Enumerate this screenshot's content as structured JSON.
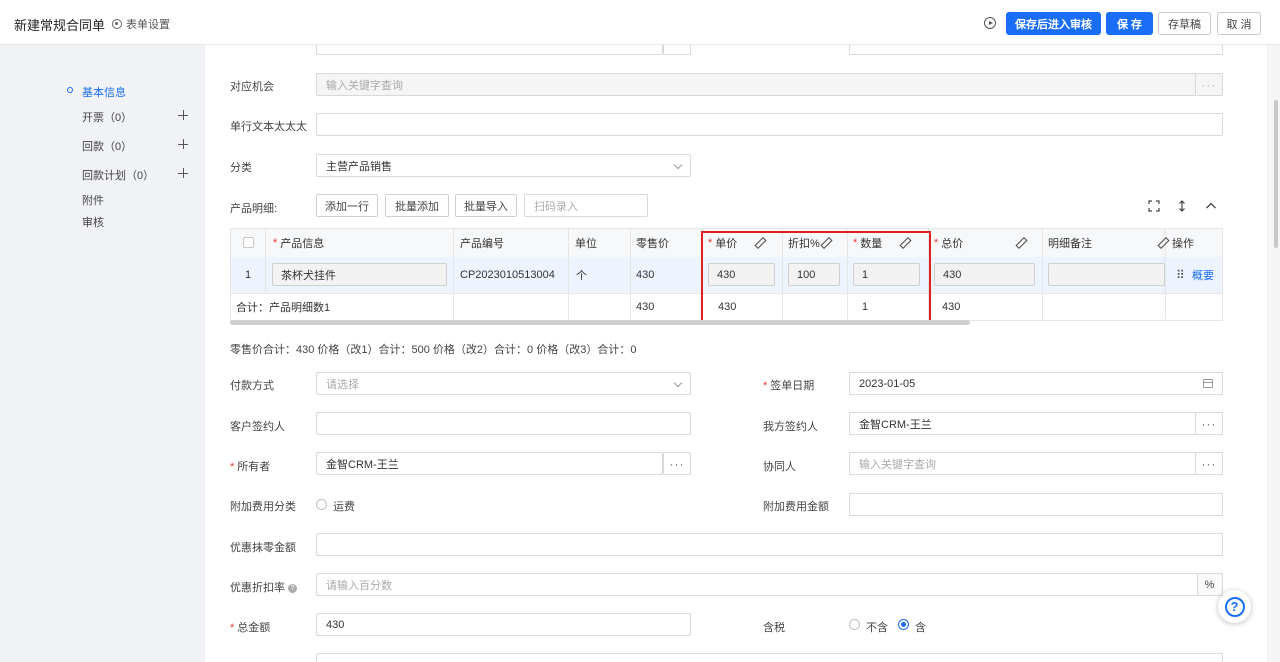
{
  "header": {
    "title": "新建常规合同单",
    "form_settings": "表单设置",
    "btn_save_review": "保存后进入审核",
    "btn_save": "保 存",
    "btn_draft": "存草稿",
    "btn_cancel": "取 消"
  },
  "nav": {
    "items": [
      {
        "label": "基本信息"
      },
      {
        "label": "开票（0）"
      },
      {
        "label": "回款（0）"
      },
      {
        "label": "回款计划（0）"
      },
      {
        "label": "附件"
      },
      {
        "label": "审核"
      }
    ]
  },
  "form": {
    "opportunity": {
      "label": "对应机会",
      "placeholder": "输入关键字查询"
    },
    "single_text": {
      "label": "单行文本太太太",
      "value": ""
    },
    "category": {
      "label": "分类",
      "value": "主营产品销售"
    },
    "product_detail": {
      "label": "产品明细:",
      "btn_add_row": "添加一行",
      "btn_batch_add": "批量添加",
      "btn_batch_import": "批量导入",
      "scan_placeholder": "扫码录入"
    },
    "summary_line": "零售价合计：430  价格（改1）合计：500  价格（改2）合计：0  价格（改3）合计：0",
    "payment_method": {
      "label": "付款方式",
      "placeholder": "请选择"
    },
    "sign_date": {
      "label": "签单日期",
      "value": "2023-01-05"
    },
    "customer_signer": {
      "label": "客户签约人",
      "value": ""
    },
    "our_signer": {
      "label": "我方签约人",
      "value": "金智CRM-王兰"
    },
    "owner": {
      "label": "所有者",
      "value": "金智CRM-王兰"
    },
    "collaborator": {
      "label": "协同人",
      "placeholder": "输入关键字查询"
    },
    "extra_fee_type": {
      "label": "附加费用分类",
      "option": "运费"
    },
    "extra_fee_amount": {
      "label": "附加费用金额",
      "value": ""
    },
    "discount_round": {
      "label": "优惠抹零金额",
      "value": ""
    },
    "discount_rate": {
      "label": "优惠折扣率",
      "placeholder": "请输入百分数",
      "suffix": "%"
    },
    "total_amount": {
      "label": "总金额",
      "value": "430"
    },
    "tax": {
      "label": "含税",
      "option_no": "不含",
      "option_yes": "含"
    },
    "dots": "···"
  },
  "table": {
    "headers": {
      "product_info": "产品信息",
      "product_code": "产品编号",
      "unit": "单位",
      "retail_price": "零售价",
      "unit_price": "单价",
      "discount": "折扣%",
      "quantity": "数量",
      "total_price": "总价",
      "remark": "明细备注",
      "action": "操作"
    },
    "row": {
      "index": "1",
      "product_info": "茶杯犬挂件",
      "product_code": "CP2023010513004",
      "unit": "个",
      "retail_price": "430",
      "unit_price": "430",
      "discount": "100",
      "quantity": "1",
      "total_price": "430",
      "action": "概要"
    },
    "total_row": {
      "label": "合计：产品明细数1",
      "retail_price": "430",
      "unit_price": "430",
      "quantity": "1",
      "total_price": "430"
    }
  },
  "colors": {
    "primary": "#1a6ef5",
    "highlight": "#e02020"
  }
}
